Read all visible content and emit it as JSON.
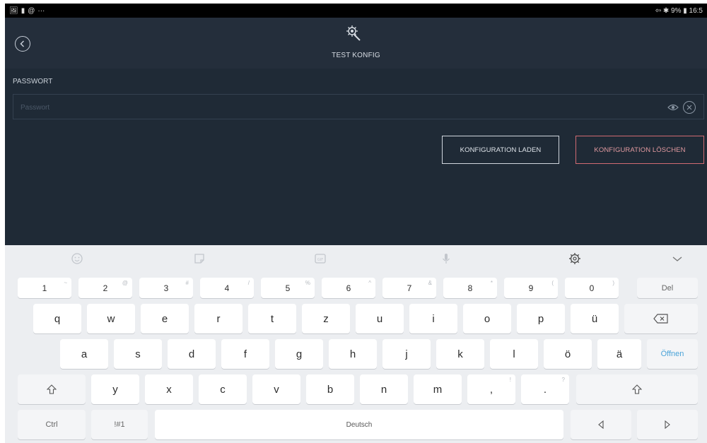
{
  "status_bar": {
    "left_icons": [
      "image-icon",
      "battery-saver-icon",
      "at-icon",
      "more-dots-icon"
    ],
    "right_text": "⇦ ✱ 9% ▮ 16:5"
  },
  "header": {
    "title": "TEST KONFIG",
    "app_icon": "magic-wand-gear-icon",
    "back_icon": "back-arrow-icon"
  },
  "form": {
    "password_label": "PASSWORT",
    "password_placeholder": "Passwort",
    "password_value": "",
    "load_button": "KONFIGURATION LADEN",
    "delete_button": "KONFIGURATION LÖSCHEN"
  },
  "colors": {
    "header_bg": "#242e3b",
    "content_bg": "#1f2a36",
    "delete_accent": "#d06a72",
    "open_key_accent": "#4aa3d8",
    "keyboard_bg": "#eceef1"
  },
  "keyboard": {
    "toolbar_icons": [
      "emoji-icon",
      "sticker-icon",
      "gif-icon",
      "microphone-icon",
      "settings-icon",
      "collapse-chevron-icon"
    ],
    "number_row": [
      {
        "label": "1",
        "hint": "~"
      },
      {
        "label": "2",
        "hint": "@"
      },
      {
        "label": "3",
        "hint": "#"
      },
      {
        "label": "4",
        "hint": "/"
      },
      {
        "label": "5",
        "hint": "%"
      },
      {
        "label": "6",
        "hint": "^"
      },
      {
        "label": "7",
        "hint": "&"
      },
      {
        "label": "8",
        "hint": "*"
      },
      {
        "label": "9",
        "hint": "("
      },
      {
        "label": "0",
        "hint": ")"
      },
      {
        "label": "Del",
        "hint": ""
      }
    ],
    "row1": [
      "q",
      "w",
      "e",
      "r",
      "t",
      "z",
      "u",
      "i",
      "o",
      "p",
      "ü"
    ],
    "row2": [
      "a",
      "s",
      "d",
      "f",
      "g",
      "h",
      "j",
      "k",
      "l",
      "ö",
      "ä"
    ],
    "open_label": "Öffnen",
    "row3": [
      "y",
      "x",
      "c",
      "v",
      "b",
      "n",
      "m"
    ],
    "comma": {
      "label": ",",
      "hint": "!"
    },
    "period": {
      "label": ".",
      "hint": "?"
    },
    "ctrl_label": "Ctrl",
    "symbols_label": "!#1",
    "space_label": "Deutsch",
    "backspace_icon": "backspace-icon",
    "shift_icon": "shift-icon",
    "left_arrow_icon": "left-arrow-icon",
    "right_arrow_icon": "right-arrow-icon"
  }
}
